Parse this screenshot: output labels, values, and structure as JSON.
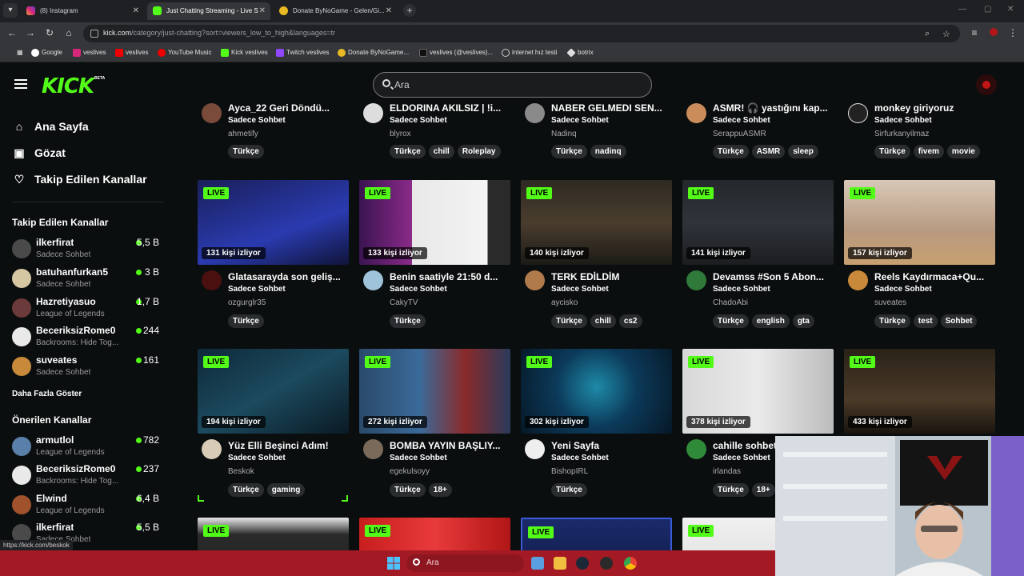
{
  "browser": {
    "tabs": [
      {
        "label": "(8) Instagram",
        "active": false
      },
      {
        "label": "Just Chatting Streaming - Live S",
        "active": true
      },
      {
        "label": "Donate ByNoGame - Gelen/Gi...",
        "active": false
      }
    ],
    "url_host": "kick.com",
    "url_path": "/category/just-chatting?sort=viewers_low_to_high&languages=tr",
    "bookmarks": [
      "Google",
      "veslives",
      "veslives",
      "YouTube Music",
      "Kick veslives",
      "Twitch veslives",
      "Donate ByNoGame...",
      "veslives (@veslives)...",
      "internet hız testi",
      "botrix"
    ],
    "status_url": "https://kick.com/beskok"
  },
  "header": {
    "logo": "KICK",
    "logo_badge": "BETA",
    "search_placeholder": "Ara"
  },
  "sidebar": {
    "nav": [
      {
        "label": "Ana Sayfa",
        "icon": "home-icon"
      },
      {
        "label": "Gözat",
        "icon": "browse-icon"
      },
      {
        "label": "Takip Edilen Kanallar",
        "icon": "heart-icon"
      }
    ],
    "followed_heading": "Takip Edilen Kanallar",
    "followed": [
      {
        "name": "ilkerfirat",
        "category": "Sadece Sohbet",
        "viewers": "5,5 B"
      },
      {
        "name": "batuhanfurkan5",
        "category": "Sadece Sohbet",
        "viewers": "3 B"
      },
      {
        "name": "Hazretiyasuo",
        "category": "League of Legends",
        "viewers": "1,7 B"
      },
      {
        "name": "BeceriksizRome0",
        "category": "Backrooms: Hide Tog...",
        "viewers": "244"
      },
      {
        "name": "suveates",
        "category": "Sadece Sohbet",
        "viewers": "161"
      }
    ],
    "show_more": "Daha Fazla Göster",
    "recommended_heading": "Önerilen Kanallar",
    "recommended": [
      {
        "name": "armutlol",
        "category": "League of Legends",
        "viewers": "782"
      },
      {
        "name": "BeceriksizRome0",
        "category": "Backrooms: Hide Tog...",
        "viewers": "237"
      },
      {
        "name": "Elwind",
        "category": "League of Legends",
        "viewers": "6,4 B"
      },
      {
        "name": "ilkerfirat",
        "category": "Sadece Sohbet",
        "viewers": "5,5 B"
      }
    ]
  },
  "live_label": "LIVE",
  "rows": [
    [
      {
        "title": "Ayca_22 Geri Döndü...",
        "category": "Sadece Sohbet",
        "user": "ahmetify",
        "tags": [
          "Türkçe"
        ]
      },
      {
        "title": "ELDORINA AKILSIZ | !i...",
        "category": "Sadece Sohbet",
        "user": "blyrox",
        "tags": [
          "Türkçe",
          "chill",
          "Roleplay"
        ]
      },
      {
        "title": "NABER GELMEDI SEN...",
        "category": "Sadece Sohbet",
        "user": "Nadinq",
        "tags": [
          "Türkçe",
          "nadinq"
        ]
      },
      {
        "title": "ASMR! 🎧 yastığını kap...",
        "category": "Sadece Sohbet",
        "user": "SerappuASMR",
        "tags": [
          "Türkçe",
          "ASMR",
          "sleep"
        ]
      },
      {
        "title": "monkey giriyoruz",
        "category": "Sadece Sohbet",
        "user": "Sirfurkanyilmaz",
        "tags": [
          "Türkçe",
          "fivem",
          "movie"
        ]
      }
    ],
    [
      {
        "viewers": "131 kişi izliyor",
        "title": "Glatasarayda son geliş...",
        "category": "Sadece Sohbet",
        "user": "ozgurglr35",
        "tags": [
          "Türkçe"
        ]
      },
      {
        "viewers": "133 kişi izliyor",
        "title": "Benin saatiyle 21:50 d...",
        "category": "Sadece Sohbet",
        "user": "CakyTV",
        "tags": [
          "Türkçe"
        ]
      },
      {
        "viewers": "140 kişi izliyor",
        "title": "TERK EDİLDİM",
        "category": "Sadece Sohbet",
        "user": "aycisko",
        "tags": [
          "Türkçe",
          "chill",
          "cs2"
        ]
      },
      {
        "viewers": "141 kişi izliyor",
        "title": "Devamss #Son 5 Abon...",
        "category": "Sadece Sohbet",
        "user": "ChadoAbi",
        "tags": [
          "Türkçe",
          "english",
          "gta"
        ]
      },
      {
        "viewers": "157 kişi izliyor",
        "title": "Reels Kaydırmaca+Qu...",
        "category": "Sadece Sohbet",
        "user": "suveates",
        "tags": [
          "Türkçe",
          "test",
          "Sohbet"
        ]
      }
    ],
    [
      {
        "viewers": "194 kişi izliyor",
        "title": "Yüz Elli Beşinci Adım!",
        "category": "Sadece Sohbet",
        "user": "Beskok",
        "tags": [
          "Türkçe",
          "gaming"
        ]
      },
      {
        "viewers": "272 kişi izliyor",
        "title": "BOMBA YAYIN BAŞLIY...",
        "category": "Sadece Sohbet",
        "user": "egekulsoyy",
        "tags": [
          "Türkçe",
          "18+"
        ]
      },
      {
        "viewers": "302 kişi izliyor",
        "title": "Yeni Sayfa",
        "category": "Sadece Sohbet",
        "user": "BishopIRL",
        "tags": [
          "Türkçe"
        ]
      },
      {
        "viewers": "378 kişi izliyor",
        "title": "cahille sohbet",
        "category": "Sadece Sohbet",
        "user": "irlandas",
        "tags": [
          "Türkçe",
          "18+"
        ]
      },
      {
        "viewers": "433 kişi izliyor",
        "title": "",
        "category": "",
        "user": "",
        "tags": []
      }
    ]
  ],
  "taskbar": {
    "search_label": "Ara"
  },
  "colors": {
    "accent": "#53fc18",
    "background": "#0b0e0f",
    "taskbar": "#a41a24"
  }
}
